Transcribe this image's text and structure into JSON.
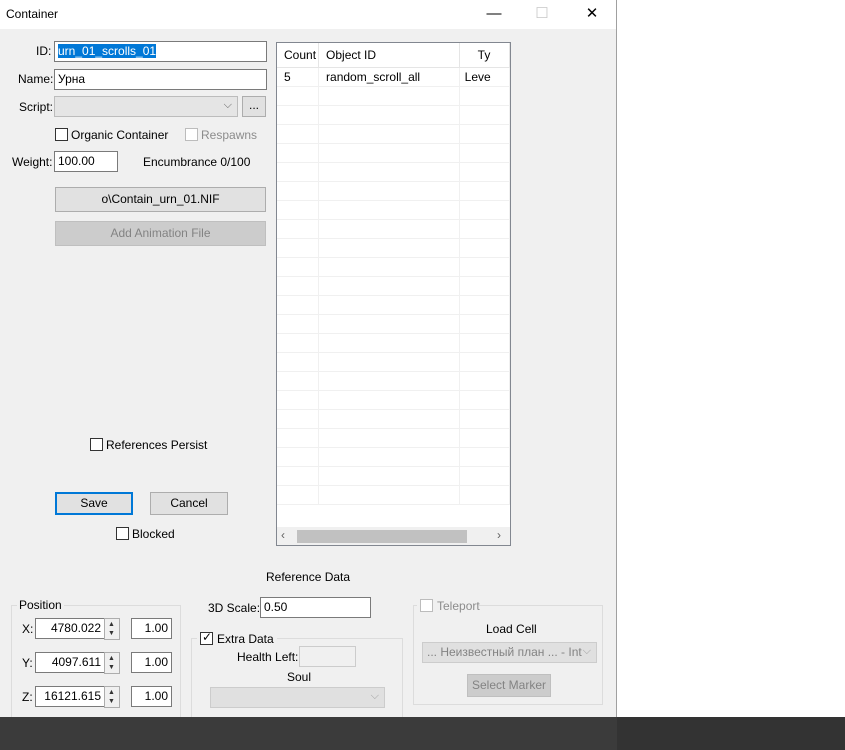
{
  "window": {
    "title": "Container",
    "minimize_glyph": "—",
    "maximize_glyph": "☐",
    "close_glyph": "✕"
  },
  "form": {
    "id_label": "ID:",
    "id_value": "urn_01_scrolls_01",
    "name_label": "Name:",
    "name_value": "Урна",
    "script_label": "Script:",
    "script_value": "",
    "script_browse_label": "...",
    "organic_label": "Organic Container",
    "organic_checked": false,
    "respawns_label": "Respawns",
    "respawns_checked": false,
    "weight_label": "Weight:",
    "weight_value": "100.00",
    "encumbrance_text": "Encumbrance 0/100",
    "model_button_label": "o\\Contain_urn_01.NIF",
    "animation_button_label": "Add Animation File",
    "references_persist_label": "References Persist",
    "save_label": "Save",
    "cancel_label": "Cancel",
    "blocked_label": "Blocked"
  },
  "inventory": {
    "columns": [
      "Count",
      "Object ID",
      "Ty"
    ],
    "rows": [
      [
        "5",
        "random_scroll_all",
        "Leve"
      ]
    ]
  },
  "reference": {
    "section_title": "Reference Data",
    "position_title": "Position",
    "x_label": "X:",
    "x_value": "4780.022",
    "x_rot": "1.00",
    "y_label": "Y:",
    "y_value": "4097.611",
    "y_rot": "1.00",
    "z_label": "Z:",
    "z_value": "16121.615",
    "z_rot": "1.00",
    "scale_label": "3D Scale:",
    "scale_value": "0.50",
    "extra_data_label": "Extra Data",
    "extra_data_checked": true,
    "health_left_label": "Health Left:",
    "health_left_value": "",
    "soul_label": "Soul",
    "soul_value": "",
    "teleport_label": "Teleport",
    "load_cell_label": "Load Cell",
    "load_cell_value": "... Неизвестный план ... - Int",
    "select_marker_label": "Select Marker"
  },
  "icons": {
    "dropdown": "chevron-down-icon",
    "spin_up": "triangle-up-icon",
    "spin_down": "triangle-down-icon",
    "scroll_left": "chevron-left-icon",
    "scroll_right": "chevron-right-icon",
    "check": "checkmark-icon"
  }
}
